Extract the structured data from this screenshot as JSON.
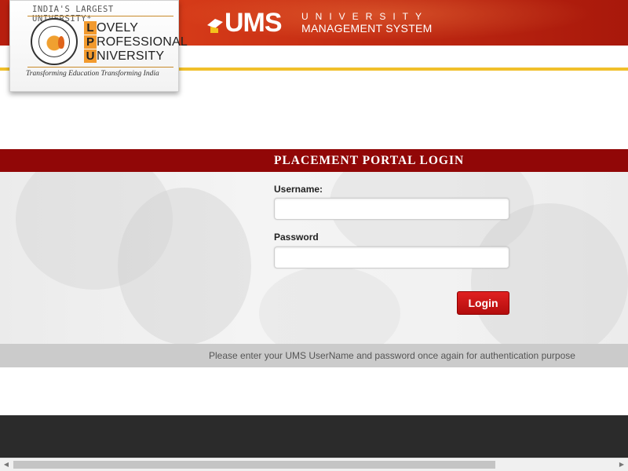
{
  "header": {
    "logo": {
      "tagline_top": "INDIA'S LARGEST UNIVERSITY*",
      "letters": [
        "L",
        "P",
        "U"
      ],
      "words": [
        "OVELY",
        "ROFESSIONAL",
        "NIVERSITY"
      ],
      "motto": "Transforming Education Transforming India"
    },
    "ums": {
      "brand": "UMS",
      "line1": "UNIVERSITY",
      "line2": "MANAGEMENT SYSTEM"
    }
  },
  "login": {
    "title": "PLACEMENT PORTAL LOGIN",
    "username_label": "Username:",
    "username_value": "",
    "password_label": "Password",
    "password_value": "",
    "button_label": "Login"
  },
  "note": "Please enter your UMS UserName and password once again for authentication purpose",
  "colors": {
    "header_red": "#c12a12",
    "banner_red": "#910707",
    "gold": "#f1c02a",
    "footer": "#2b2b2b"
  }
}
